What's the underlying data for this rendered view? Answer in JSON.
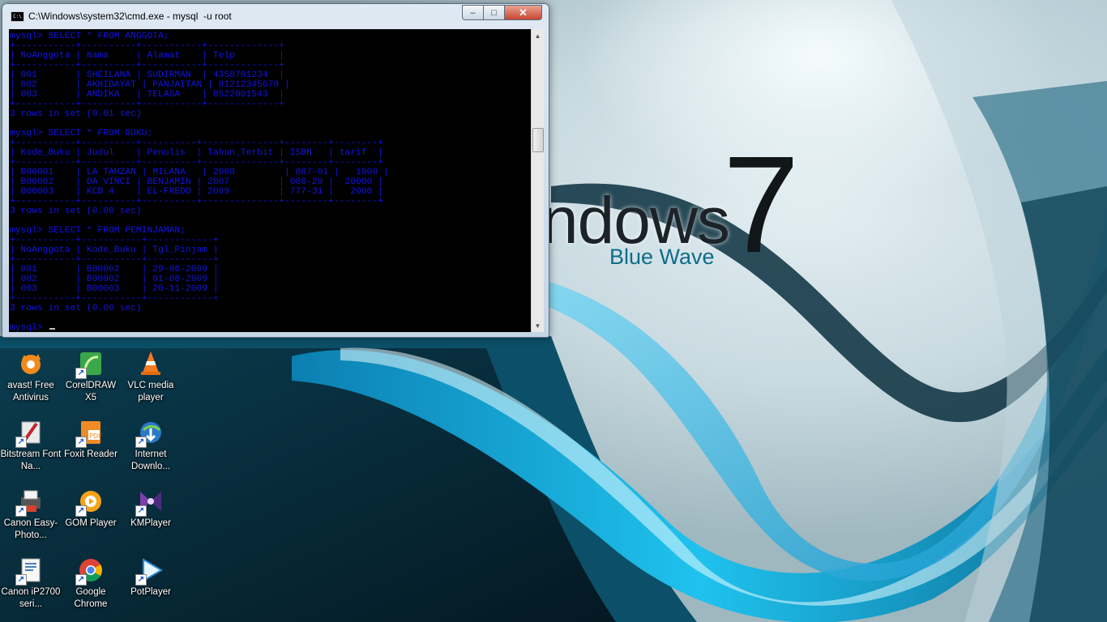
{
  "wallpaper": {
    "brand_text": "ndows",
    "brand_number": "7",
    "brand_sub": "Blue Wave"
  },
  "cmd_window": {
    "title": "C:\\Windows\\system32\\cmd.exe - mysql  -u root",
    "icon_label": "C:\\",
    "controls": {
      "minimize": "‒",
      "maximize": "□",
      "close": "✕"
    },
    "console_lines": [
      "mysql> SELECT * FROM ANGGOTA;",
      "+-----------+----------+-----------+-------------+",
      "| NoAnggota | Nama     | Alamat    | Telp        |",
      "+-----------+----------+-----------+-------------+",
      "| 001       | SHEILANA | SUDIRMAN  | 4358701234  |",
      "| 002       | AKHIDAYAT | PANJAITAN | 81212345678 |",
      "| 003       | ANDIKA   | TELAGA    | 8522001543  |",
      "+-----------+----------+-----------+-------------+",
      "3 rows in set (0.01 sec)",
      "",
      "mysql> SELECT * FROM BUKU;",
      "+-----------+----------+----------+--------------+--------+--------+",
      "| Kode_Buku | Judul    | Penulis  | Tahun_Terbit | ISBN   | tarif  |",
      "+-----------+----------+----------+--------------+--------+--------+",
      "| B00001    | LA TAHZAN | MILANA   | 2008         | 087-01 |   1000 |",
      "| B00002    | DA VINCI | BENJAMIN | 2007         | 088-29 |  20000 |",
      "| B00003    | KCB 4    | EL-FREDO | 2009         | 777-31 |   2000 |",
      "+-----------+----------+----------+--------------+--------+--------+",
      "3 rows in set (0.00 sec)",
      "",
      "mysql> SELECT * FROM PEMINJAMAN;",
      "+-----------+-----------+------------+",
      "| NoAnggota | Kode_Buku | Tgl_Pinjam |",
      "+-----------+-----------+------------+",
      "| 001       | B00002    | 29-06-2009 |",
      "| 002       | B00002    | 01-08-2009 |",
      "| 003       | B00003    | 20-11-2009 |",
      "+-----------+-----------+------------+",
      "3 rows in set (0.00 sec)",
      "",
      "mysql> "
    ]
  },
  "desktop_icons": [
    {
      "name": "avast",
      "label": "avast! Free Antivirus"
    },
    {
      "name": "coreldraw",
      "label": "CorelDRAW X5"
    },
    {
      "name": "vlc",
      "label": "VLC media player"
    },
    {
      "name": "bitstream",
      "label": "Bitstream Font Na..."
    },
    {
      "name": "foxit",
      "label": "Foxit Reader"
    },
    {
      "name": "idm",
      "label": "Internet Downlo..."
    },
    {
      "name": "canon-photo",
      "label": "Canon Easy-Photo..."
    },
    {
      "name": "gom",
      "label": "GOM Player"
    },
    {
      "name": "kmplayer",
      "label": "KMPlayer"
    },
    {
      "name": "canon-ip2700",
      "label": "Canon iP2700 seri..."
    },
    {
      "name": "chrome",
      "label": "Google Chrome"
    },
    {
      "name": "potplayer",
      "label": "PotPlayer"
    }
  ]
}
